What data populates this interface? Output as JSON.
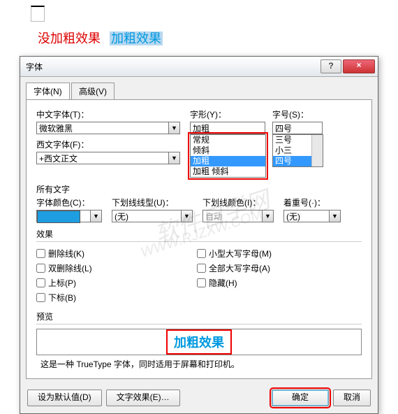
{
  "top": {
    "not_bold": "没加粗效果",
    "bold": "加粗效果"
  },
  "dialog": {
    "title": "字体",
    "help": "?",
    "close": "×"
  },
  "tabs": {
    "font": "字体(N)",
    "adv": "高级(V)"
  },
  "lbl": {
    "cfont": "中文字体(T)：",
    "wfont": "西文字体(F)：",
    "style": "字形(Y)：",
    "size": "字号(S)：",
    "alltext": "所有文字",
    "color": "字体颜色(C)：",
    "underline": "下划线线型(U)：",
    "ulcolor": "下划线颜色(I)：",
    "emph": "着重号(·)：",
    "effects": "效果",
    "preview": "预览"
  },
  "val": {
    "cfont": "微软雅黑",
    "wfont": "+西文正文",
    "style": "加粗",
    "size": "四号",
    "style_list": [
      "常规",
      "倾斜",
      "加粗",
      "加粗 倾斜"
    ],
    "size_list": [
      "三号",
      "小三",
      "四号"
    ],
    "underline": "(无)",
    "ulcolor": "自动",
    "emph": "(无)",
    "color_hex": "#1e9de0"
  },
  "chk": {
    "strike": "删除线(K)",
    "dstrike": "双删除线(L)",
    "sup": "上标(P)",
    "sub": "下标(B)",
    "smallcaps": "小型大写字母(M)",
    "allcaps": "全部大写字母(A)",
    "hidden": "隐藏(H)"
  },
  "preview": {
    "text": "加粗效果",
    "note": "这是一种 TrueType 字体，同时适用于屏幕和打印机。"
  },
  "btns": {
    "default": "设为默认值(D)",
    "texteff": "文字效果(E)…",
    "ok": "确定",
    "cancel": "取消"
  },
  "watermarks": {
    "a": "软件自学网",
    "b": "WWW.RJZXW.COM"
  }
}
